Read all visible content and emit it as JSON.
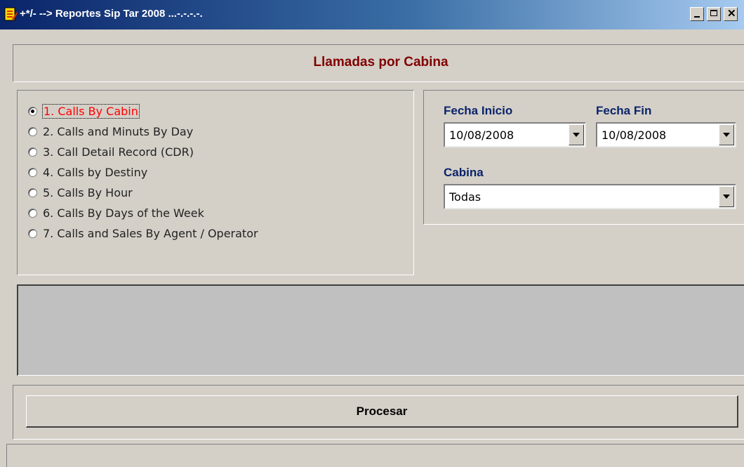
{
  "window": {
    "title": "+*/- --> Reportes Sip Tar 2008 ...-.-.-.-.",
    "icon": "notepad-app-icon",
    "controls": {
      "minimize": "minimize-icon",
      "maximize": "maximize-icon",
      "close": "✕"
    }
  },
  "header": {
    "title": "Llamadas por Cabina"
  },
  "reports": {
    "selected_index": 0,
    "options": [
      "1. Calls By Cabin",
      "2. Calls and Minuts By Day",
      "3. Call Detail Record (CDR)",
      "4. Calls by Destiny",
      "5. Calls By Hour",
      "6. Calls By Days of the Week",
      "7. Calls and Sales By Agent / Operator"
    ]
  },
  "filters": {
    "start_date_label": "Fecha Inicio",
    "start_date_value": "10/08/2008",
    "end_date_label": "Fecha Fin",
    "end_date_value": "10/08/2008",
    "cabin_label": "Cabina",
    "cabin_value": "Todas"
  },
  "actions": {
    "process_label": "Procesar"
  },
  "colors": {
    "titlebar_start": "#0a246a",
    "header_title": "#800000",
    "field_label": "#0a246a",
    "selected_option": "#ff0000",
    "window_bg": "#d4d0c8"
  }
}
